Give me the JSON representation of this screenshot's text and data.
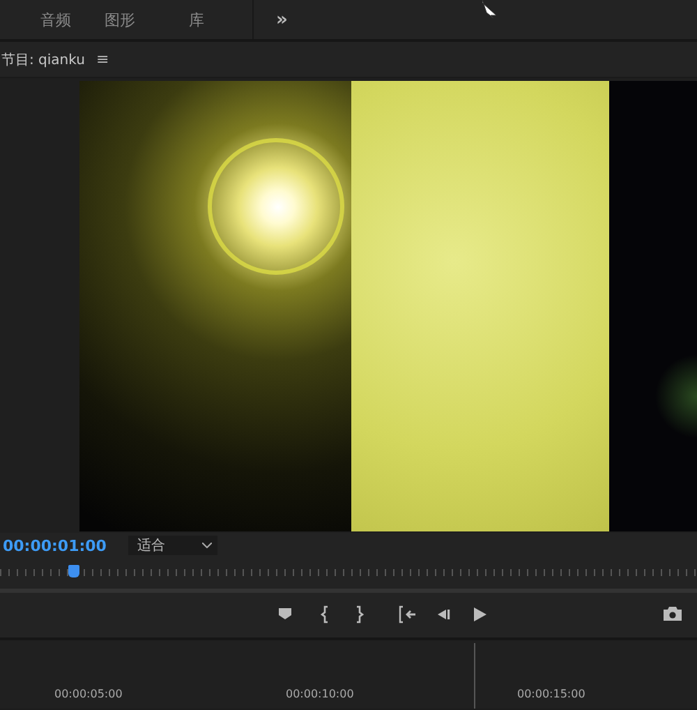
{
  "workspace_tabs": [
    {
      "label": "音频"
    },
    {
      "label": "图形"
    },
    {
      "label": "库"
    }
  ],
  "overflow_button": "»",
  "panel": {
    "title": "节目: qianku",
    "menu": "≡"
  },
  "monitor": {
    "timecode": "00:00:01:00",
    "zoom": "适合",
    "playhead": {
      "level": 0.105
    }
  },
  "transport": [
    {
      "kind": "marker"
    },
    {
      "kind": "mark-in"
    },
    {
      "kind": "mark-out"
    },
    {
      "kind": "go-to-in"
    },
    {
      "kind": "step-back"
    },
    {
      "kind": "play"
    },
    {
      "kind": "export-frame"
    }
  ],
  "timeline": {
    "time_labels": [
      "00:00:05:00",
      "00:00:10:00",
      "00:00:15:00"
    ]
  }
}
